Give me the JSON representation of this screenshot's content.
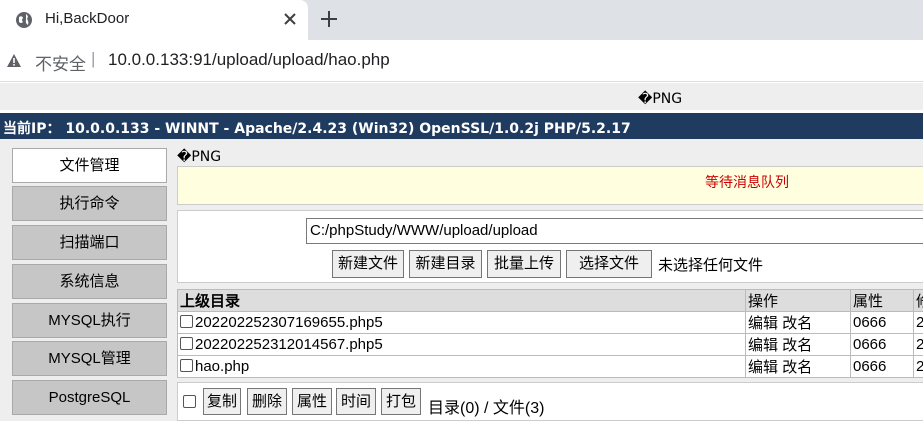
{
  "browser": {
    "tab_title": "Hi,BackDoor",
    "security_label": "不安全",
    "url": "10.0.0.133:91/upload/upload/hao.php"
  },
  "page": {
    "png_marker": "�PNG",
    "server_info": "当前IP： 10.0.0.133 - WINNT - Apache/2.4.23 (Win32) OpenSSL/1.0.2j PHP/5.2.17",
    "menu": [
      "文件管理",
      "执行命令",
      "扫描端口",
      "系统信息",
      "MYSQL执行",
      "MYSQL管理",
      "PostgreSQL"
    ],
    "active_menu": "文件管理",
    "message": "等待消息队列",
    "path_value": "C:/phpStudy/WWW/upload/upload",
    "toolbar": {
      "new_file": "新建文件",
      "new_dir": "新建目录",
      "batch_upload": "批量上传",
      "choose_file": "选择文件",
      "no_file": "未选择任何文件"
    },
    "table": {
      "headers": [
        "上级目录",
        "操作",
        "属性",
        "修"
      ],
      "rows": [
        {
          "name": "202202252307169655.php5",
          "edit": "编辑",
          "rename": "改名",
          "perm": "0666",
          "mod": "2"
        },
        {
          "name": "202202252312014567.php5",
          "edit": "编辑",
          "rename": "改名",
          "perm": "0666",
          "mod": "2"
        },
        {
          "name": "hao.php",
          "edit": "编辑",
          "rename": "改名",
          "perm": "0666",
          "mod": "2"
        }
      ]
    },
    "footer": {
      "copy": "复制",
      "delete": "删除",
      "attr": "属性",
      "time": "时间",
      "pack": "打包",
      "counts": "目录(0) / 文件(3)"
    }
  }
}
